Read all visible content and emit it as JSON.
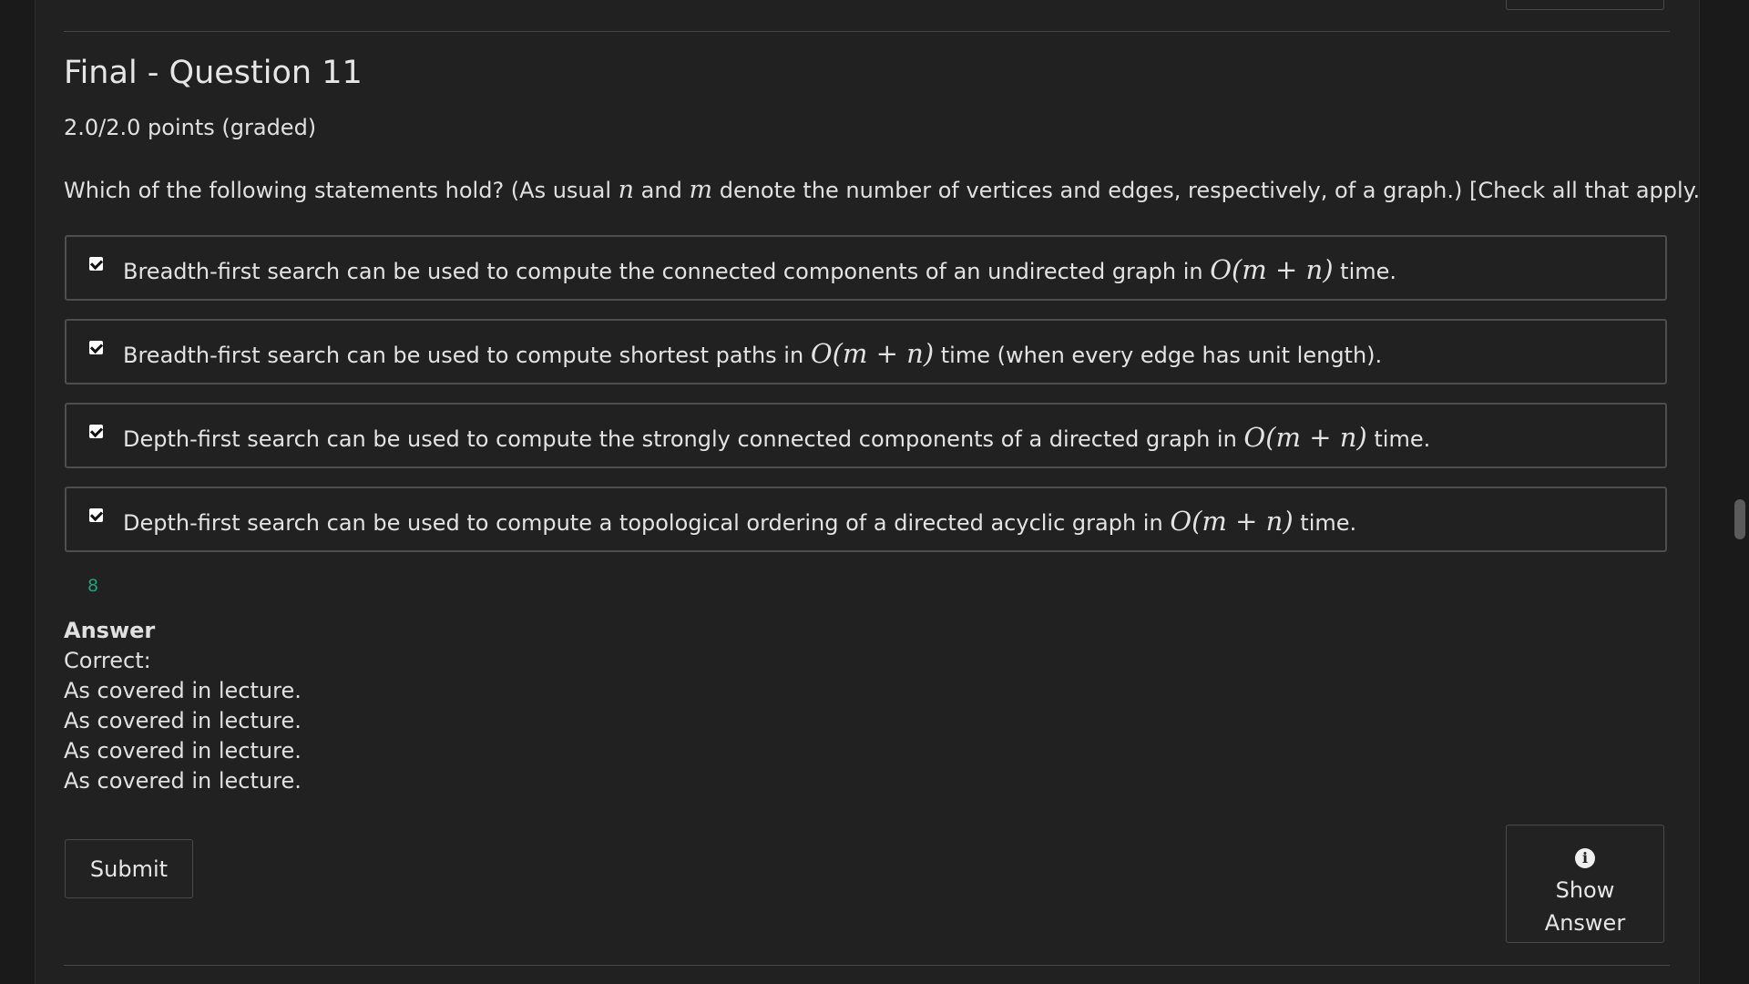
{
  "problem": {
    "title": "Final - Question 11",
    "points": "2.0/2.0 points (graded)",
    "prompt": {
      "before_n": "Which of the following statements hold? (As usual ",
      "var_n": "n",
      "between": " and ",
      "var_m": "m",
      "after_m": " denote the number of vertices and edges, respectively, of a graph.) [Check all that apply.]"
    },
    "choices": [
      {
        "before": "Breadth-first search can be used to compute the connected components of an undirected graph in ",
        "math": "O(m + n)",
        "after": " time.",
        "checked": true
      },
      {
        "before": "Breadth-first search can be used to compute shortest paths in ",
        "math": "O(m + n)",
        "after": " time (when every edge has unit length).",
        "checked": true
      },
      {
        "before": "Depth-first search can be used to compute the strongly connected components of a directed graph in ",
        "math": "O(m + n)",
        "after": " time.",
        "checked": true
      },
      {
        "before": "Depth-first search can be used to compute a topological ordering of a directed acyclic graph in ",
        "math": "O(m + n)",
        "after": " time.",
        "checked": true
      }
    ],
    "status_value": "8",
    "answer": {
      "heading": "Answer",
      "correct_label": "Correct:",
      "explanations": [
        "As covered in lecture.",
        "As covered in lecture.",
        "As covered in lecture.",
        "As covered in lecture."
      ]
    },
    "submit_label": "Submit",
    "show_answer": {
      "icon": "info-icon",
      "icon_glyph": "i",
      "label": "Show Answer"
    }
  },
  "colors": {
    "background": "#212121",
    "text": "#e0e0e0",
    "border": "#4e4e4e",
    "score": "#1fa37b"
  }
}
